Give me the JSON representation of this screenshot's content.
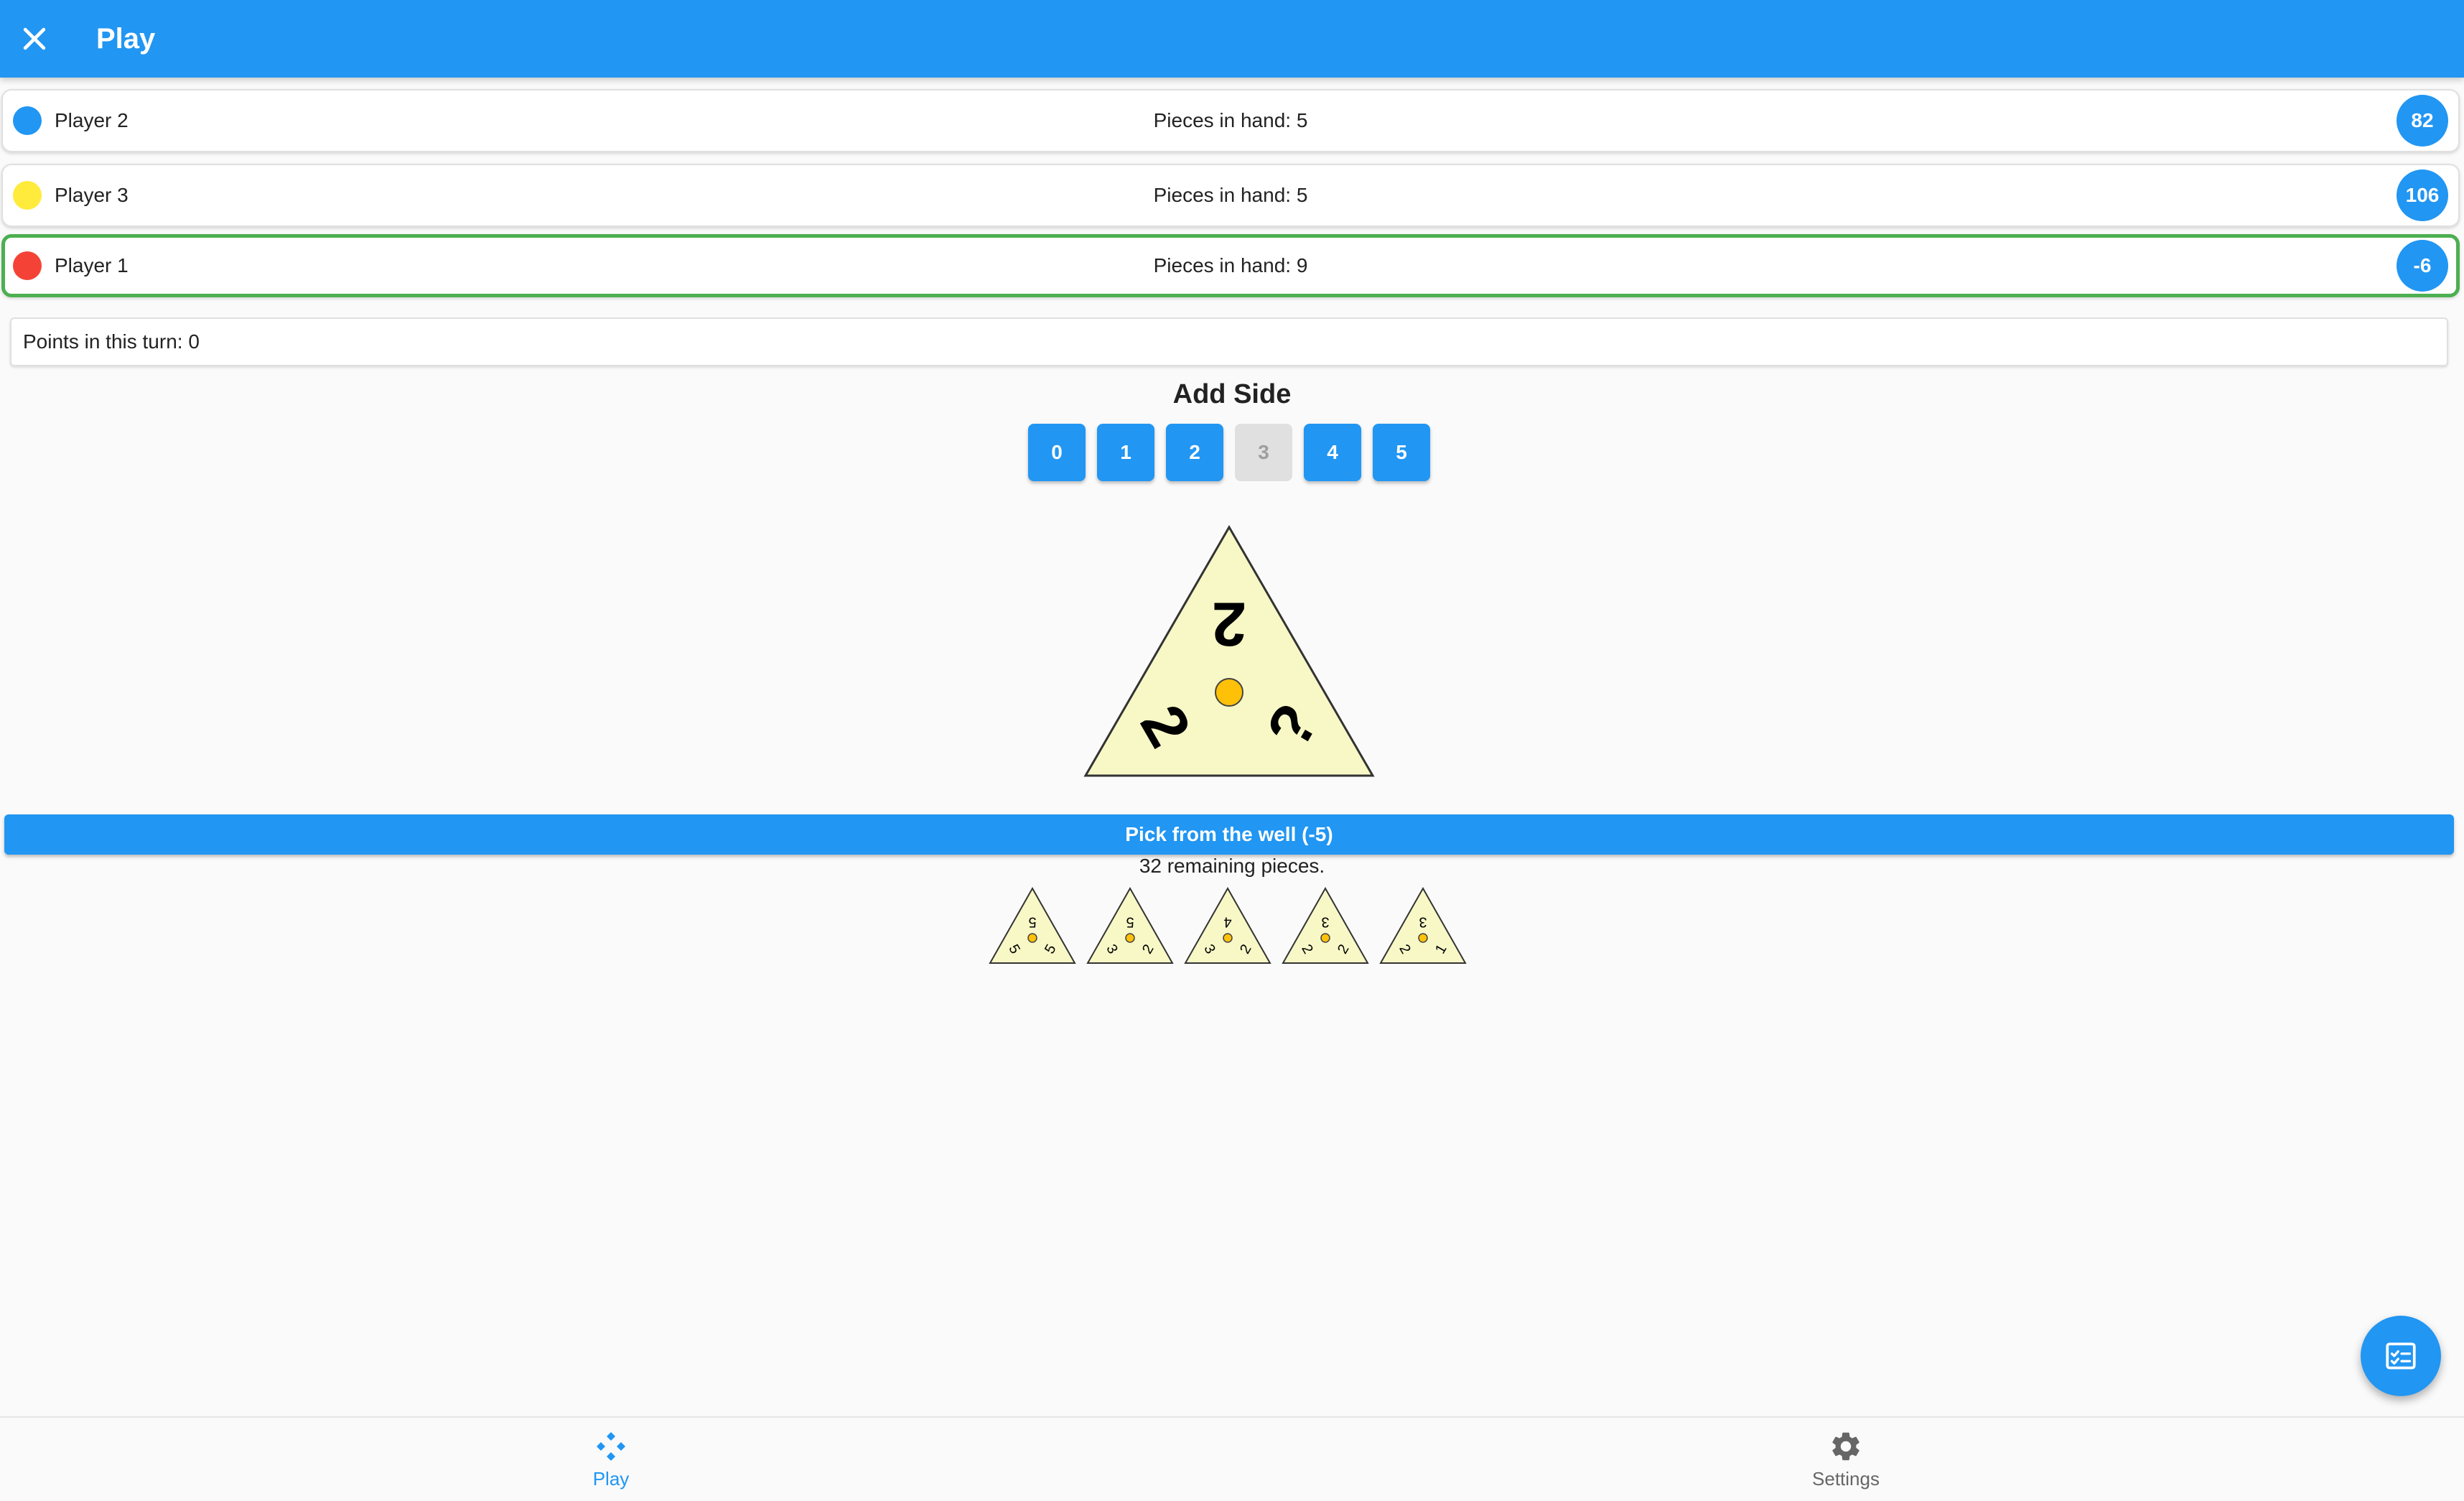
{
  "appbar": {
    "title": "Play",
    "close_icon": "close-icon"
  },
  "players": [
    {
      "name": "Player 2",
      "color": "#2196f3",
      "pieces_label": "Pieces in hand: 5",
      "score": "82",
      "active": false
    },
    {
      "name": "Player 3",
      "color": "#ffeb3b",
      "pieces_label": "Pieces in hand: 5",
      "score": "106",
      "active": false
    },
    {
      "name": "Player 1",
      "color": "#f44336",
      "pieces_label": "Pieces in hand: 9",
      "score": "-6",
      "active": true
    }
  ],
  "points_turn": "Points in this turn: 0",
  "add_side": {
    "title": "Add Side",
    "buttons": [
      {
        "label": "0",
        "enabled": true
      },
      {
        "label": "1",
        "enabled": true
      },
      {
        "label": "2",
        "enabled": true
      },
      {
        "label": "3",
        "enabled": false
      },
      {
        "label": "4",
        "enabled": true
      },
      {
        "label": "5",
        "enabled": true
      }
    ]
  },
  "current_tile": {
    "top": "2",
    "left": "2",
    "right": "?"
  },
  "well": {
    "button_label": "Pick from the well (-5)",
    "remaining": "32 remaining pieces."
  },
  "hand": [
    {
      "top": "5",
      "left": "5",
      "right": "5"
    },
    {
      "top": "5",
      "left": "3",
      "right": "2"
    },
    {
      "top": "4",
      "left": "3",
      "right": "2"
    },
    {
      "top": "3",
      "left": "2",
      "right": "2"
    },
    {
      "top": "3",
      "left": "2",
      "right": "1"
    }
  ],
  "fab": {
    "icon": "checklist-icon"
  },
  "bottom_nav": [
    {
      "label": "Play",
      "icon": "gamepad-icon",
      "active": true
    },
    {
      "label": "Settings",
      "icon": "gear-icon",
      "active": false
    }
  ],
  "colors": {
    "primary": "#2196f3",
    "tile_fill": "#f7f8c6",
    "tile_center": "#ffc107",
    "active_border": "#4caf50"
  }
}
